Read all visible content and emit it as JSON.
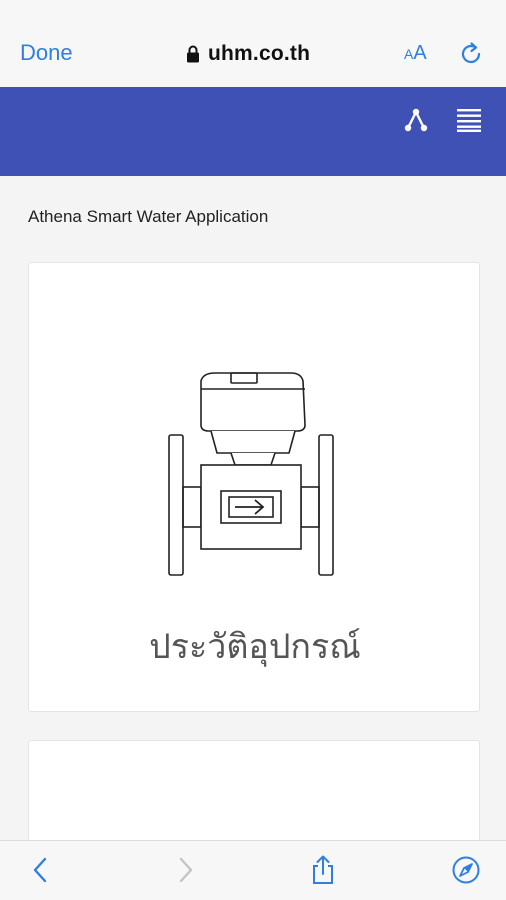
{
  "browser": {
    "done_label": "Done",
    "url": "uhm.co.th",
    "text_size_small": "A",
    "text_size_big": "A",
    "accent_color": "#2f7fe0"
  },
  "site": {
    "header_color": "#3f51b5",
    "header_icons": [
      "share-icon",
      "menu-icon"
    ]
  },
  "page": {
    "app_title": "Athena Smart Water Application",
    "cards": [
      {
        "label": "ประวัติอุปกรณ์",
        "icon": "water-meter-icon"
      }
    ]
  },
  "toolbar": {
    "icons": [
      "back-icon",
      "forward-icon",
      "share-sheet-icon",
      "compass-icon"
    ]
  }
}
